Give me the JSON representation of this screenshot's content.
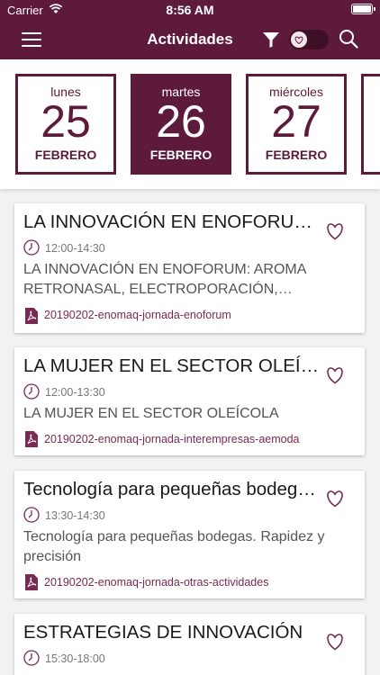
{
  "status_bar": {
    "carrier": "Carrier",
    "time": "8:56 AM"
  },
  "nav": {
    "title": "Actividades",
    "accent_color": "#5e1a3a"
  },
  "icons": {
    "menu": "hamburger-menu-icon",
    "filter": "cocktail-filter-icon",
    "favorites_toggle": "heart-toggle-icon",
    "search": "search-icon",
    "favorite": "heart-outline-icon",
    "time": "clock-icon",
    "file": "pdf-icon"
  },
  "days": [
    {
      "weekday": "lunes",
      "day": "25",
      "month": "FEBRERO",
      "selected": false
    },
    {
      "weekday": "martes",
      "day": "26",
      "month": "FEBRERO",
      "selected": true
    },
    {
      "weekday": "miércoles",
      "day": "27",
      "month": "FEBRERO",
      "selected": false
    }
  ],
  "events": [
    {
      "title": "LA INNOVACIÓN EN ENOFORUM: AROMA RETRONASAL, ELECTROPORACIÓN, CALENTAMIENTO",
      "time": "12:00-14:30",
      "description": "LA INNOVACIÓN EN ENOFORUM: AROMA RETRONASAL, ELECTROPORACIÓN, CALENTAMIENTO",
      "file": "20190202-enomaq-jornada-enoforum"
    },
    {
      "title": "LA MUJER EN EL SECTOR OLEÍCOLA",
      "time": "12:00-13:30",
      "description": "LA MUJER EN EL SECTOR OLEÍCOLA",
      "file": "20190202-enomaq-jornada-interempresas-aemoda"
    },
    {
      "title": "Tecnología para pequeñas bodegas. Rapidez y precisión",
      "time": "13:30-14:30",
      "description": "Tecnología para pequeñas bodegas. Rapidez y precisión",
      "file": "20190202-enomaq-jornada-otras-actividades"
    },
    {
      "title": "ESTRATEGIAS DE INNOVACIÓN",
      "time": "15:30-18:00",
      "description": "",
      "file": ""
    }
  ]
}
